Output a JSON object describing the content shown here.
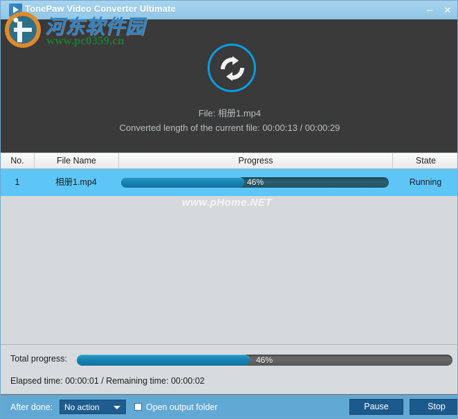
{
  "window": {
    "title": "TonePaw Video Converter Ultimate",
    "app_icon": "play-video-icon",
    "minimize_label": "–",
    "close_label": "×"
  },
  "hero": {
    "status_icon": "sync-refresh-icon",
    "accent_color": "#0a9ee0",
    "background_color": "#3a3a3a",
    "file_line": "File: 相册1.mp4",
    "length_line": "Converted length of the current file: 00:00:13 / 00:00:29"
  },
  "table": {
    "columns": [
      "No.",
      "File Name",
      "Progress",
      "State"
    ],
    "rows": [
      {
        "no": "1",
        "file_name": "相册1.mp4",
        "progress_percent": 46,
        "progress_label": "46%",
        "state": "Running",
        "selected": true
      }
    ],
    "selected_row_color": "#5ec6f7",
    "body_color": "#d6d9dc"
  },
  "bottom": {
    "total_progress_label": "Total progress:",
    "total_progress_percent": 46,
    "total_progress_value": "46%",
    "times_line": "Elapsed time: 00:00:01 / Remaining time: 00:00:02"
  },
  "footer": {
    "after_done_label": "After done:",
    "after_done_value": "No action",
    "dropdown_icon": "chevron-down-icon",
    "open_output_folder_label": "Open output folder",
    "open_output_folder_checked": false,
    "pause_label": "Pause",
    "stop_label": "Stop",
    "background_color": "#62a8d4",
    "button_color": "#1c5a8c"
  },
  "watermarks": {
    "logo_text": "河东软件园",
    "logo_url": "www.pc0359.cn",
    "center_text": "www.pHome.NET"
  }
}
